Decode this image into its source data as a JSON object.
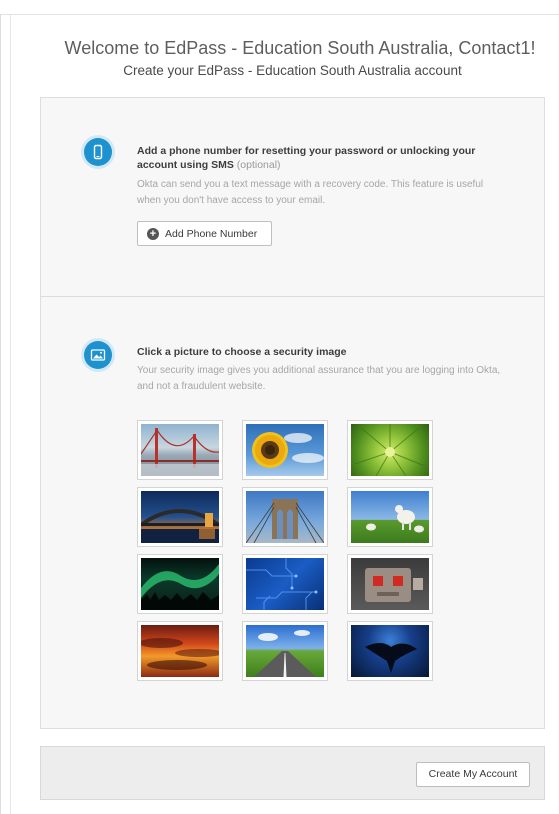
{
  "header": {
    "title": "Welcome to EdPass - Education South Australia, Contact1!",
    "subtitle": "Create your EdPass - Education South Australia account"
  },
  "phone_section": {
    "icon": "phone-icon",
    "heading": "Add a phone number for resetting your password or unlocking your account using SMS",
    "optional_label": "(optional)",
    "description": "Okta can send you a text message with a recovery code. This feature is useful when you don't have access to your email.",
    "button_label": "Add Phone Number"
  },
  "security_image_section": {
    "icon": "image-icon",
    "heading": "Click a picture to choose a security image",
    "description": "Your security image gives you additional assurance that you are logging into Okta, and not a fraudulent website.",
    "images": [
      {
        "name": "golden-gate-bridge"
      },
      {
        "name": "sunflower"
      },
      {
        "name": "green-succulent"
      },
      {
        "name": "harbour-bridge-night"
      },
      {
        "name": "brooklyn-bridge"
      },
      {
        "name": "lambs-in-field"
      },
      {
        "name": "aurora-borealis"
      },
      {
        "name": "circuit-board"
      },
      {
        "name": "robot-toy"
      },
      {
        "name": "sunset-clouds"
      },
      {
        "name": "open-road"
      },
      {
        "name": "manta-ray"
      }
    ]
  },
  "footer": {
    "create_button_label": "Create My Account"
  },
  "colors": {
    "accent": "#1e92cf",
    "panel_bg": "#f7f7f7",
    "footer_bg": "#ededed"
  }
}
